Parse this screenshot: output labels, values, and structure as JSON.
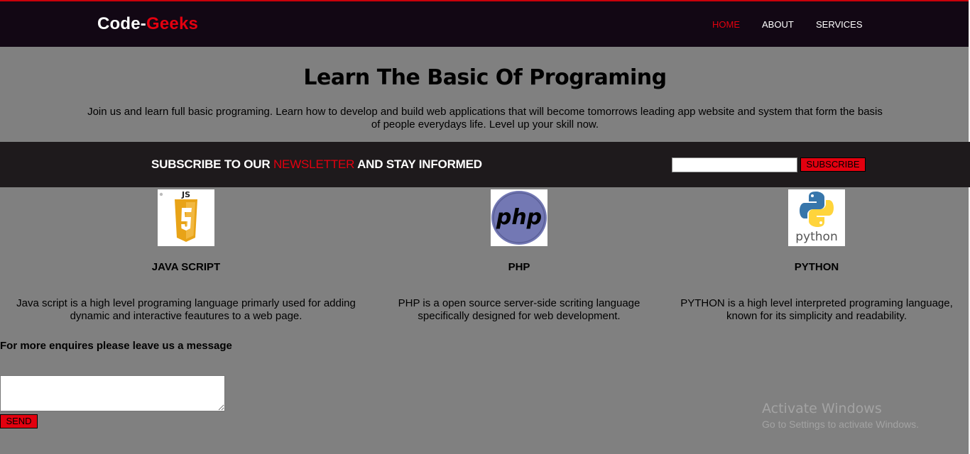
{
  "header": {
    "logo_primary": "Code-",
    "logo_accent": "Geeks",
    "nav": [
      {
        "label": "HOME",
        "active": true
      },
      {
        "label": "ABOUT",
        "active": false
      },
      {
        "label": "SERVICES",
        "active": false
      }
    ]
  },
  "hero": {
    "title": "Learn The Basic Of Programing",
    "text": "Join us and learn full basic programing. Learn how to develop and build web applications that will become tomorrows leading app website and system that form the basis of people everydays life. Level up your skill now."
  },
  "newsletter": {
    "heading_before": "SUBSCRIBE TO OUR",
    "heading_highlight": "NEWSLETTER",
    "heading_after": "AND STAY INFORMED",
    "input_value": "",
    "button_label": "SUBSCRIBE"
  },
  "cards": [
    {
      "icon": "javascript-logo-icon",
      "logo_text": "JS",
      "title": "JAVA SCRIPT",
      "description": "Java script is a high level programing language primarly used for adding dynamic and interactive feautures to a web page."
    },
    {
      "icon": "php-logo-icon",
      "logo_text": "php",
      "title": "PHP",
      "description": "PHP is a open source server-side scriting language specifically designed for web development."
    },
    {
      "icon": "python-logo-icon",
      "logo_text": "python",
      "title": "PYTHON",
      "description": "PYTHON is a high level interpreted programing language, known for its simplicity and readability."
    }
  ],
  "contact": {
    "label": "For more enquires please leave us a message",
    "message_value": "",
    "send_label": "SEND"
  },
  "watermark": {
    "title": "Activate Windows",
    "subtitle": "Go to Settings to activate Windows."
  },
  "colors": {
    "page_bg": "#808080",
    "header_bg": "#120714",
    "newsletter_bg": "#1e1a1c",
    "accent": "#e3000f"
  }
}
